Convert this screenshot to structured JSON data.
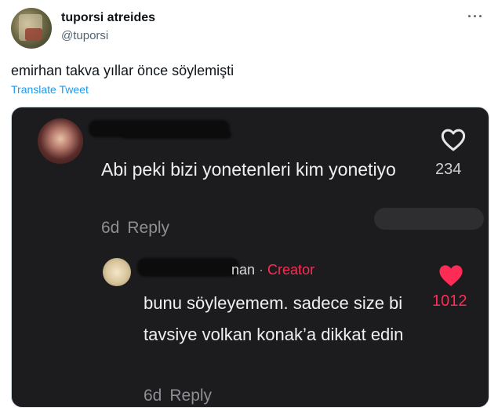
{
  "tweet": {
    "display_name": "tuporsi atreides",
    "handle": "@tuporsi",
    "more_icon": "ellipsis-icon",
    "text": "emirhan takva yıllar önce söylemişti",
    "translate_label": "Translate Tweet"
  },
  "media": {
    "comment": {
      "text": "Abi peki bizi yonetenleri kim yonetiyo",
      "age": "6d",
      "reply_label": "Reply",
      "like_count": "234",
      "like_icon": "heart-outline-icon"
    },
    "reply": {
      "name_suffix": "nan",
      "separator": "·",
      "creator_label": "Creator",
      "text": "bunu söyleyemem. sadece size bi tavsiye volkan konak’a dikkat edin",
      "age": "6d",
      "reply_label": "Reply",
      "like_count": "1012",
      "like_icon": "heart-filled-icon"
    },
    "colors": {
      "background": "#1c1c1e",
      "creator": "#fe2c55",
      "muted": "#8e8e93"
    }
  }
}
